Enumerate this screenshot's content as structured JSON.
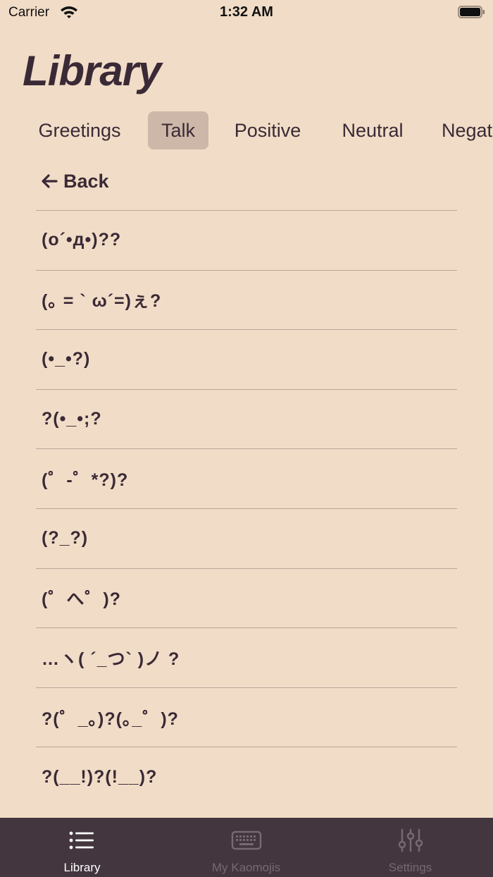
{
  "status": {
    "carrier": "Carrier",
    "time": "1:32 AM"
  },
  "page": {
    "title": "Library"
  },
  "tabs": [
    {
      "label": "Greetings",
      "active": false
    },
    {
      "label": "Talk",
      "active": true
    },
    {
      "label": "Positive",
      "active": false
    },
    {
      "label": "Neutral",
      "active": false
    },
    {
      "label": "Negat",
      "active": false
    }
  ],
  "back": {
    "label": "Back",
    "icon": "arrow-left-icon"
  },
  "kaomojis": [
    "(o´•д•)??",
    "(｡ = ` ω´=)ぇ?",
    "(•_•?)",
    "?(•_•;?",
    "(゜-゜*?)?",
    "(?_?)",
    "(゜へ゜)?",
    "…ヽ( ´_つ` )ノ ?",
    "?(゜_｡)?(｡_゜)?",
    "?(__!)?(!__)?"
  ],
  "tab_bar": {
    "items": [
      {
        "label": "Library",
        "icon": "list-icon",
        "active": true
      },
      {
        "label": "My Kaomojis",
        "icon": "keyboard-icon",
        "active": false
      },
      {
        "label": "Settings",
        "icon": "sliders-icon",
        "active": false
      }
    ]
  },
  "colors": {
    "background": "#f1dcc7",
    "text": "#3a2a36",
    "active_tab": "#cdb7a8",
    "tab_bar": "#43363f",
    "tab_bar_inactive": "#77696f"
  }
}
